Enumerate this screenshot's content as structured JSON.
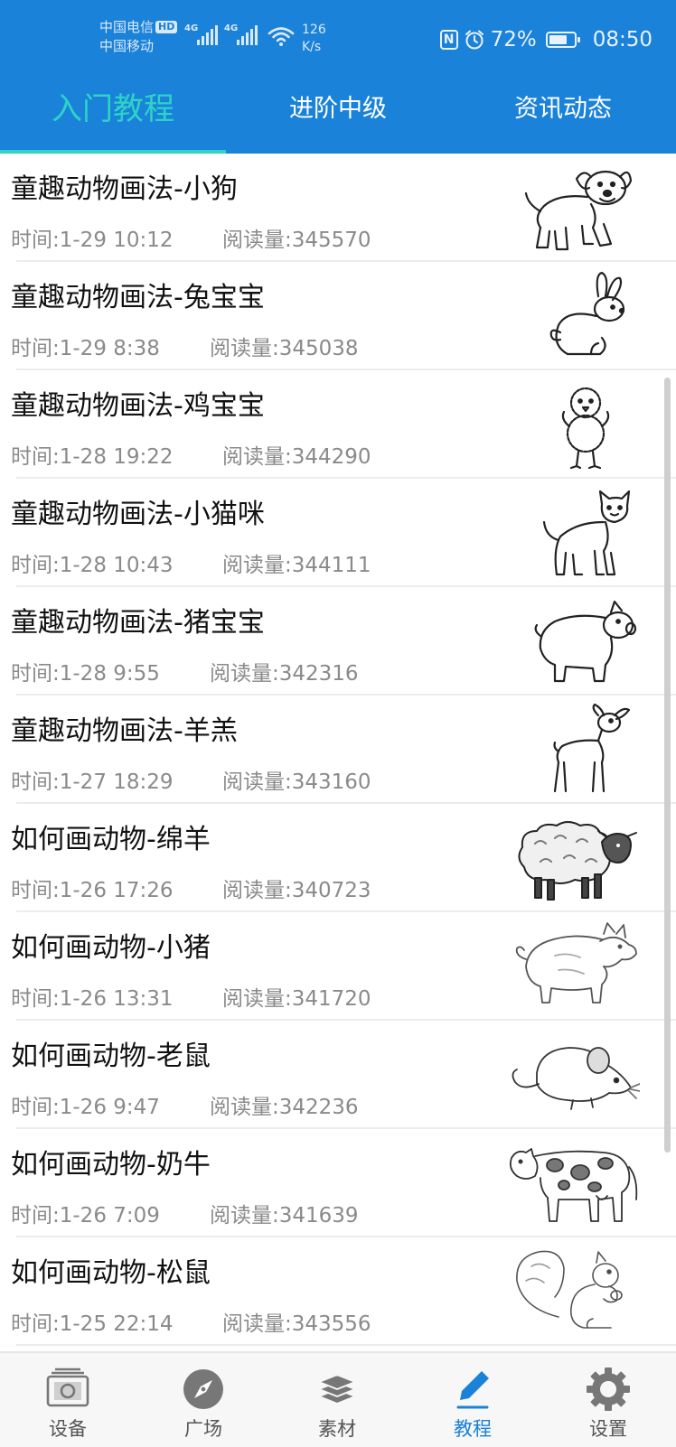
{
  "status_bar": {
    "carrier1": "中国电信",
    "hd_badge": "HD",
    "carrier2": "中国移动",
    "net1": "4G",
    "net2": "4G",
    "speed_value": "126",
    "speed_unit": "K/s",
    "nfc_label": "N",
    "battery_percent": "72%",
    "battery_level": 0.72,
    "time": "08:50",
    "icons": [
      "signal-icon",
      "wifi-icon",
      "nfc-icon",
      "alarm-icon",
      "battery-icon"
    ]
  },
  "tabs": [
    {
      "label": "入门教程",
      "active": true
    },
    {
      "label": "进阶中级",
      "active": false
    },
    {
      "label": "资讯动态",
      "active": false
    }
  ],
  "colors": {
    "header_bg": "#1a82d9",
    "active_tab": "#2ed3c8",
    "nav_active": "#1a82d9"
  },
  "articles": [
    {
      "title": "童趣动物画法-小狗",
      "time": "时间:1-29 10:12",
      "reads": "阅读量:345570",
      "thumb": "dog"
    },
    {
      "title": "童趣动物画法-兔宝宝",
      "time": "时间:1-29 8:38",
      "reads": "阅读量:345038",
      "thumb": "rabbit"
    },
    {
      "title": "童趣动物画法-鸡宝宝",
      "time": "时间:1-28 19:22",
      "reads": "阅读量:344290",
      "thumb": "chick"
    },
    {
      "title": "童趣动物画法-小猫咪",
      "time": "时间:1-28 10:43",
      "reads": "阅读量:344111",
      "thumb": "cat"
    },
    {
      "title": "童趣动物画法-猪宝宝",
      "time": "时间:1-28 9:55",
      "reads": "阅读量:342316",
      "thumb": "pig"
    },
    {
      "title": "童趣动物画法-羊羔",
      "time": "时间:1-27 18:29",
      "reads": "阅读量:343160",
      "thumb": "lamb"
    },
    {
      "title": "如何画动物-绵羊",
      "time": "时间:1-26 17:26",
      "reads": "阅读量:340723",
      "thumb": "sheep"
    },
    {
      "title": "如何画动物-小猪",
      "time": "时间:1-26 13:31",
      "reads": "阅读量:341720",
      "thumb": "piglet"
    },
    {
      "title": "如何画动物-老鼠",
      "time": "时间:1-26 9:47",
      "reads": "阅读量:342236",
      "thumb": "mouse"
    },
    {
      "title": "如何画动物-奶牛",
      "time": "时间:1-26 7:09",
      "reads": "阅读量:341639",
      "thumb": "cow"
    },
    {
      "title": "如何画动物-松鼠",
      "time": "时间:1-25 22:14",
      "reads": "阅读量:343556",
      "thumb": "squirrel"
    }
  ],
  "bottom_nav": [
    {
      "label": "设备",
      "icon": "device-icon",
      "active": false
    },
    {
      "label": "广场",
      "icon": "compass-icon",
      "active": false
    },
    {
      "label": "素材",
      "icon": "layers-icon",
      "active": false
    },
    {
      "label": "教程",
      "icon": "pencil-icon",
      "active": true
    },
    {
      "label": "设置",
      "icon": "gear-icon",
      "active": false
    }
  ]
}
